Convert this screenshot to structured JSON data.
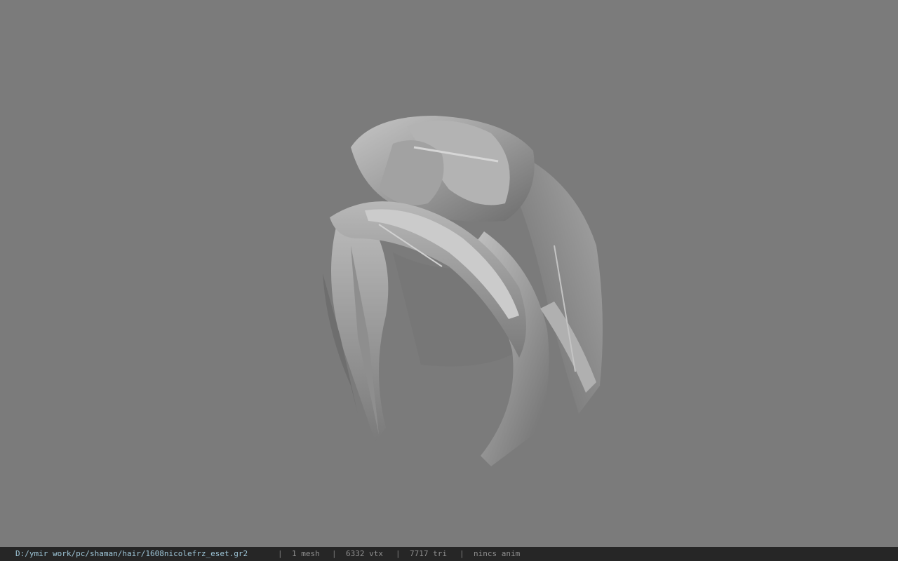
{
  "viewport": {
    "background_color": "#7b7b7b",
    "model_icon": "hair-mesh-render"
  },
  "status": {
    "file_path": "D:/ymir work/pc/shaman/hair/1608nicolefrz_eset.gr2",
    "separator": "|",
    "mesh_count": "1 mesh",
    "vertex_count": "6332 vtx",
    "triangle_count": "7717 tri",
    "anim_status": "nincs anim"
  },
  "colors": {
    "status_bg": "#262626",
    "status_text": "#8f8f8f",
    "path_text": "#9ec6d8",
    "hair_base": "#9a9a9a",
    "hair_highlight": "#c8c8c8",
    "hair_shadow": "#5c5c5c"
  }
}
